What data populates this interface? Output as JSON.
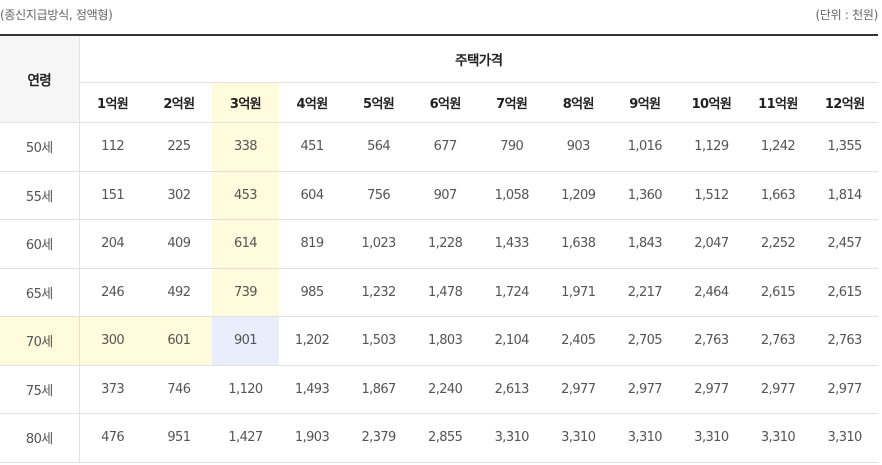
{
  "caption_left": "(종신지급방식, 정액형)",
  "caption_right": "(단위 : 천원)",
  "header": {
    "age_label": "연령",
    "price_label": "주택가격",
    "prices": [
      "1억원",
      "2억원",
      "3억원",
      "4억원",
      "5억원",
      "6억원",
      "7억원",
      "8억원",
      "9억원",
      "10억원",
      "11억원",
      "12억원"
    ]
  },
  "rows": [
    {
      "age": "50세",
      "values": [
        "112",
        "225",
        "338",
        "451",
        "564",
        "677",
        "790",
        "903",
        "1,016",
        "1,129",
        "1,242",
        "1,355"
      ]
    },
    {
      "age": "55세",
      "values": [
        "151",
        "302",
        "453",
        "604",
        "756",
        "907",
        "1,058",
        "1,209",
        "1,360",
        "1,512",
        "1,663",
        "1,814"
      ]
    },
    {
      "age": "60세",
      "values": [
        "204",
        "409",
        "614",
        "819",
        "1,023",
        "1,228",
        "1,433",
        "1,638",
        "1,843",
        "2,047",
        "2,252",
        "2,457"
      ]
    },
    {
      "age": "65세",
      "values": [
        "246",
        "492",
        "739",
        "985",
        "1,232",
        "1,478",
        "1,724",
        "1,971",
        "2,217",
        "2,464",
        "2,615",
        "2,615"
      ]
    },
    {
      "age": "70세",
      "values": [
        "300",
        "601",
        "901",
        "1,202",
        "1,503",
        "1,803",
        "2,104",
        "2,405",
        "2,705",
        "2,763",
        "2,763",
        "2,763"
      ]
    },
    {
      "age": "75세",
      "values": [
        "373",
        "746",
        "1,120",
        "1,493",
        "1,867",
        "2,240",
        "2,613",
        "2,977",
        "2,977",
        "2,977",
        "2,977",
        "2,977"
      ]
    },
    {
      "age": "80세",
      "values": [
        "476",
        "951",
        "1,427",
        "1,903",
        "2,379",
        "2,855",
        "3,310",
        "3,310",
        "3,310",
        "3,310",
        "3,310",
        "3,310"
      ]
    }
  ],
  "highlight": {
    "column_index": 2,
    "row_index": 4,
    "colors": {
      "band": "#fffbdc",
      "cross": "#e8eefb"
    }
  }
}
